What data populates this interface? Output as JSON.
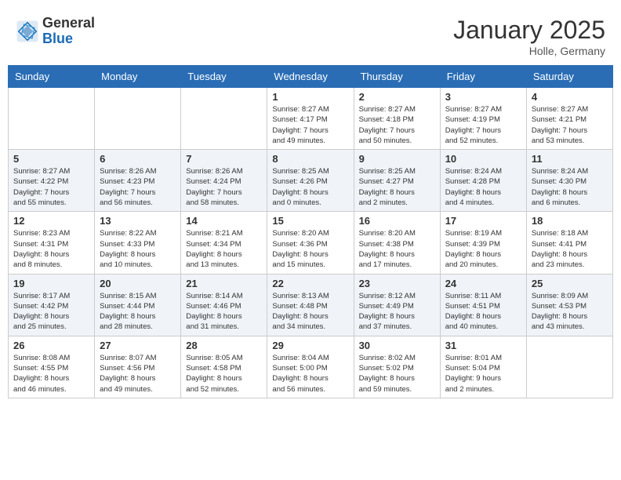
{
  "header": {
    "logo_general": "General",
    "logo_blue": "Blue",
    "month_title": "January 2025",
    "location": "Holle, Germany"
  },
  "weekdays": [
    "Sunday",
    "Monday",
    "Tuesday",
    "Wednesday",
    "Thursday",
    "Friday",
    "Saturday"
  ],
  "weeks": [
    [
      {
        "day": "",
        "info": ""
      },
      {
        "day": "",
        "info": ""
      },
      {
        "day": "",
        "info": ""
      },
      {
        "day": "1",
        "info": "Sunrise: 8:27 AM\nSunset: 4:17 PM\nDaylight: 7 hours\nand 49 minutes."
      },
      {
        "day": "2",
        "info": "Sunrise: 8:27 AM\nSunset: 4:18 PM\nDaylight: 7 hours\nand 50 minutes."
      },
      {
        "day": "3",
        "info": "Sunrise: 8:27 AM\nSunset: 4:19 PM\nDaylight: 7 hours\nand 52 minutes."
      },
      {
        "day": "4",
        "info": "Sunrise: 8:27 AM\nSunset: 4:21 PM\nDaylight: 7 hours\nand 53 minutes."
      }
    ],
    [
      {
        "day": "5",
        "info": "Sunrise: 8:27 AM\nSunset: 4:22 PM\nDaylight: 7 hours\nand 55 minutes."
      },
      {
        "day": "6",
        "info": "Sunrise: 8:26 AM\nSunset: 4:23 PM\nDaylight: 7 hours\nand 56 minutes."
      },
      {
        "day": "7",
        "info": "Sunrise: 8:26 AM\nSunset: 4:24 PM\nDaylight: 7 hours\nand 58 minutes."
      },
      {
        "day": "8",
        "info": "Sunrise: 8:25 AM\nSunset: 4:26 PM\nDaylight: 8 hours\nand 0 minutes."
      },
      {
        "day": "9",
        "info": "Sunrise: 8:25 AM\nSunset: 4:27 PM\nDaylight: 8 hours\nand 2 minutes."
      },
      {
        "day": "10",
        "info": "Sunrise: 8:24 AM\nSunset: 4:28 PM\nDaylight: 8 hours\nand 4 minutes."
      },
      {
        "day": "11",
        "info": "Sunrise: 8:24 AM\nSunset: 4:30 PM\nDaylight: 8 hours\nand 6 minutes."
      }
    ],
    [
      {
        "day": "12",
        "info": "Sunrise: 8:23 AM\nSunset: 4:31 PM\nDaylight: 8 hours\nand 8 minutes."
      },
      {
        "day": "13",
        "info": "Sunrise: 8:22 AM\nSunset: 4:33 PM\nDaylight: 8 hours\nand 10 minutes."
      },
      {
        "day": "14",
        "info": "Sunrise: 8:21 AM\nSunset: 4:34 PM\nDaylight: 8 hours\nand 13 minutes."
      },
      {
        "day": "15",
        "info": "Sunrise: 8:20 AM\nSunset: 4:36 PM\nDaylight: 8 hours\nand 15 minutes."
      },
      {
        "day": "16",
        "info": "Sunrise: 8:20 AM\nSunset: 4:38 PM\nDaylight: 8 hours\nand 17 minutes."
      },
      {
        "day": "17",
        "info": "Sunrise: 8:19 AM\nSunset: 4:39 PM\nDaylight: 8 hours\nand 20 minutes."
      },
      {
        "day": "18",
        "info": "Sunrise: 8:18 AM\nSunset: 4:41 PM\nDaylight: 8 hours\nand 23 minutes."
      }
    ],
    [
      {
        "day": "19",
        "info": "Sunrise: 8:17 AM\nSunset: 4:42 PM\nDaylight: 8 hours\nand 25 minutes."
      },
      {
        "day": "20",
        "info": "Sunrise: 8:15 AM\nSunset: 4:44 PM\nDaylight: 8 hours\nand 28 minutes."
      },
      {
        "day": "21",
        "info": "Sunrise: 8:14 AM\nSunset: 4:46 PM\nDaylight: 8 hours\nand 31 minutes."
      },
      {
        "day": "22",
        "info": "Sunrise: 8:13 AM\nSunset: 4:48 PM\nDaylight: 8 hours\nand 34 minutes."
      },
      {
        "day": "23",
        "info": "Sunrise: 8:12 AM\nSunset: 4:49 PM\nDaylight: 8 hours\nand 37 minutes."
      },
      {
        "day": "24",
        "info": "Sunrise: 8:11 AM\nSunset: 4:51 PM\nDaylight: 8 hours\nand 40 minutes."
      },
      {
        "day": "25",
        "info": "Sunrise: 8:09 AM\nSunset: 4:53 PM\nDaylight: 8 hours\nand 43 minutes."
      }
    ],
    [
      {
        "day": "26",
        "info": "Sunrise: 8:08 AM\nSunset: 4:55 PM\nDaylight: 8 hours\nand 46 minutes."
      },
      {
        "day": "27",
        "info": "Sunrise: 8:07 AM\nSunset: 4:56 PM\nDaylight: 8 hours\nand 49 minutes."
      },
      {
        "day": "28",
        "info": "Sunrise: 8:05 AM\nSunset: 4:58 PM\nDaylight: 8 hours\nand 52 minutes."
      },
      {
        "day": "29",
        "info": "Sunrise: 8:04 AM\nSunset: 5:00 PM\nDaylight: 8 hours\nand 56 minutes."
      },
      {
        "day": "30",
        "info": "Sunrise: 8:02 AM\nSunset: 5:02 PM\nDaylight: 8 hours\nand 59 minutes."
      },
      {
        "day": "31",
        "info": "Sunrise: 8:01 AM\nSunset: 5:04 PM\nDaylight: 9 hours\nand 2 minutes."
      },
      {
        "day": "",
        "info": ""
      }
    ]
  ]
}
